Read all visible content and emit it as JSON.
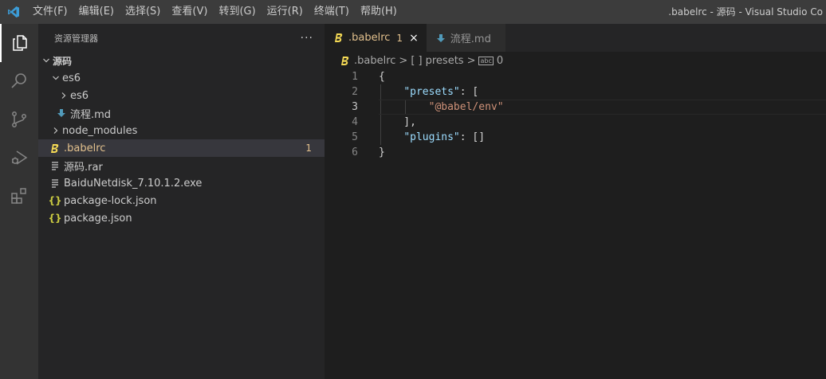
{
  "titlebar": {
    "menu": [
      "文件(F)",
      "编辑(E)",
      "选择(S)",
      "查看(V)",
      "转到(G)",
      "运行(R)",
      "终端(T)",
      "帮助(H)"
    ],
    "window_title": ".babelrc - 源码 - Visual Studio Co"
  },
  "activity_bar": {
    "icons": [
      "explorer-icon",
      "search-icon",
      "source-control-icon",
      "run-debug-icon",
      "extensions-icon"
    ]
  },
  "sidebar": {
    "header": "资源管理器",
    "more": "···",
    "tree": {
      "root": "源码",
      "es6": "es6",
      "es6_sub": "es6",
      "flow_md": "流程.md",
      "node_modules": "node_modules",
      "babelrc": ".babelrc",
      "babelrc_badge": "1",
      "rar": "源码.rar",
      "exe": "BaiduNetdisk_7.10.1.2.exe",
      "package_lock": "package-lock.json",
      "package": "package.json"
    }
  },
  "editor": {
    "tabs": [
      {
        "label": ".babelrc",
        "badge": "1",
        "close": "×"
      },
      {
        "label": "流程.md"
      }
    ],
    "breadcrumb": {
      "file": ".babelrc",
      "sep": ">",
      "key_icon": "[ ]",
      "key": "presets",
      "str_icon": "abc",
      "index": "0"
    },
    "lines": [
      {
        "n": "1",
        "tokens": [
          {
            "t": "{",
            "c": "punc"
          }
        ]
      },
      {
        "n": "2",
        "tokens": [
          {
            "t": "    ",
            "c": "punc"
          },
          {
            "t": "\"presets\"",
            "c": "key"
          },
          {
            "t": ": [",
            "c": "punc"
          }
        ]
      },
      {
        "n": "3",
        "tokens": [
          {
            "t": "        ",
            "c": "punc"
          },
          {
            "t": "\"@babel/env\"",
            "c": "str"
          }
        ]
      },
      {
        "n": "4",
        "tokens": [
          {
            "t": "    ],",
            "c": "punc"
          }
        ]
      },
      {
        "n": "5",
        "tokens": [
          {
            "t": "    ",
            "c": "punc"
          },
          {
            "t": "\"plugins\"",
            "c": "key"
          },
          {
            "t": ": []",
            "c": "punc"
          }
        ]
      },
      {
        "n": "6",
        "tokens": [
          {
            "t": "}",
            "c": "punc"
          }
        ]
      }
    ]
  },
  "colors": {
    "accent_blue": "#3c9cd7",
    "warning": "#e2c08d",
    "babel_yellow": "#f5da55",
    "json_yellow": "#cbcb41",
    "md_blue": "#519aba"
  }
}
